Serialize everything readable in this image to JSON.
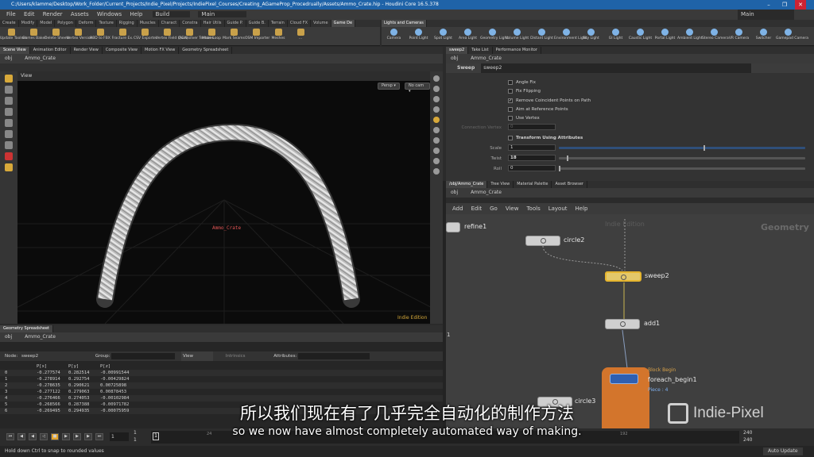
{
  "window": {
    "title": "C:/Users/klamme/Desktop/Work_Folder/Current_Projects/Indie_Pixel/Projects/IndiePixel_Courses/Creating_AGameProp_Procedrually/Assets/Ammo_Crate.hip - Houdini Core 16.5.378",
    "minimize": "–",
    "maximize": "❐",
    "close": "✕"
  },
  "menu": {
    "items": [
      "File",
      "Edit",
      "Render",
      "Assets",
      "Windows",
      "Help"
    ],
    "build": "Build",
    "main_left": "Main",
    "main_right": "Main"
  },
  "shelf_left": {
    "tabs": [
      "Create",
      "Modify",
      "Model",
      "Polygon",
      "Deform",
      "Texture",
      "Rigging",
      "Muscles",
      "Charact",
      "Constra",
      "Hair Utils",
      "Guide P.",
      "Guide B.",
      "Terrain",
      "Cloud FX",
      "Volume",
      "Game De"
    ],
    "tools": [
      "Update Toolset",
      "Games Baker",
      "Delete Sheets",
      "Vertex Version",
      "RBD to FBX",
      "Fracture Ex.",
      "CSV Exporter",
      "Vertex Field (FGA)",
      "Quicksilver Textures",
      "Make Loop",
      "Mark Seams",
      "OSM Importer",
      "Meshes",
      "..."
    ]
  },
  "shelf_right": {
    "tabs": [
      "Lights and Cameras"
    ],
    "tools": [
      "Camera",
      "Point Light",
      "Spot Light",
      "Area Light",
      "Geometry Light",
      "Volume Light",
      "Distant Light",
      "Environment Light",
      "Sky Light",
      "GI Light",
      "Caustic Light",
      "Portal Light",
      "Ambient Light",
      "Stereo Camera",
      "VR Camera",
      "Switcher",
      "Gamepad Camera"
    ]
  },
  "left_pane": {
    "tabs": [
      "Scene View",
      "Animation Editor",
      "Render View",
      "Composite View",
      "Motion FX View",
      "Geometry Spreadsheet"
    ],
    "path": [
      "obj",
      "Ammo_Crate"
    ],
    "view_label": "View",
    "persp": "Persp ▾",
    "nocam": "No cam ▾",
    "object_label": "Ammo_Crate",
    "watermark": "Indie Edition"
  },
  "spreadsheet": {
    "tab": "Geometry Spreadsheet",
    "path": [
      "obj",
      "Ammo_Crate"
    ],
    "node_label": "Node:",
    "node_value": "sweep2",
    "group_label": "Group:",
    "view_label": "View",
    "intrinsics_label": "Intrinsics",
    "attributes_label": "Attributes:",
    "columns": [
      "",
      "P[x]",
      "P[y]",
      "P[z]"
    ],
    "rows": [
      [
        "0",
        "-0.277574",
        "0.282514",
        "-0.00991544"
      ],
      [
        "1",
        "-0.278914",
        "0.292754",
        "-0.00429824"
      ],
      [
        "2",
        "-0.278635",
        "0.290621",
        "0.00725898"
      ],
      [
        "3",
        "-0.277122",
        "0.279063",
        "0.00878453"
      ],
      [
        "4",
        "-0.276466",
        "0.274053",
        "-0.00102984"
      ],
      [
        "5",
        "-0.268566",
        "0.287388",
        "-0.00971782"
      ],
      [
        "6",
        "-0.269495",
        "0.294935",
        "-0.00075959"
      ]
    ]
  },
  "right_pane": {
    "tabs": [
      "sweep2",
      "Take List",
      "Performance Monitor"
    ],
    "path": [
      "obj",
      "Ammo_Crate"
    ],
    "node_type": "Sweep",
    "node_name": "sweep2",
    "params": {
      "angle_fix": "Angle Fix",
      "fix_flipping": "Fix Flipping",
      "remove_coincident": "Remove Coincident Points on Path",
      "aim_ref": "Aim at Reference Points",
      "use_vertex": "Use Vertex",
      "connection_vertex": "Connection Vertex",
      "connection_vertex_value": "0",
      "transform_attr": "Transform Using Attributes",
      "scale_label": "Scale",
      "scale_value": "1",
      "twist_label": "Twist",
      "twist_value": "18",
      "roll_label": "Roll",
      "roll_value": "0",
      "checkmark": "✓"
    }
  },
  "network": {
    "tabs": [
      "/obj/Ammo_Crate",
      "Tree View",
      "Material Palette",
      "Asset Browser"
    ],
    "path": [
      "obj",
      "Ammo_Crate"
    ],
    "menu": [
      "Add",
      "Edit",
      "Go",
      "View",
      "Tools",
      "Layout",
      "Help"
    ],
    "watermark": "Indie Edition",
    "context": "Geometry",
    "row_marker": "1",
    "nodes": {
      "refine": "refine1",
      "circle2": "circle2",
      "sweep2": "sweep2",
      "add1": "add1",
      "block_label": "Block Begin",
      "foreach": "foreach_begin1",
      "piece": "Piece : 4",
      "circle3": "circle3"
    }
  },
  "timeline": {
    "frame": "1",
    "start": "1",
    "start2": "1",
    "ticks": [
      "24",
      "192"
    ],
    "end_a": "240",
    "end_b": "240",
    "frame_box": "1"
  },
  "status": {
    "hint": "Hold down Ctrl to snap to rounded values",
    "auto_update": "Auto Update"
  },
  "subtitle": {
    "cn": "所以我们现在有了几乎完全自动化的制作方法",
    "en": "so we now have almost completely automated way of making."
  },
  "logo": "Indie-Pixel"
}
